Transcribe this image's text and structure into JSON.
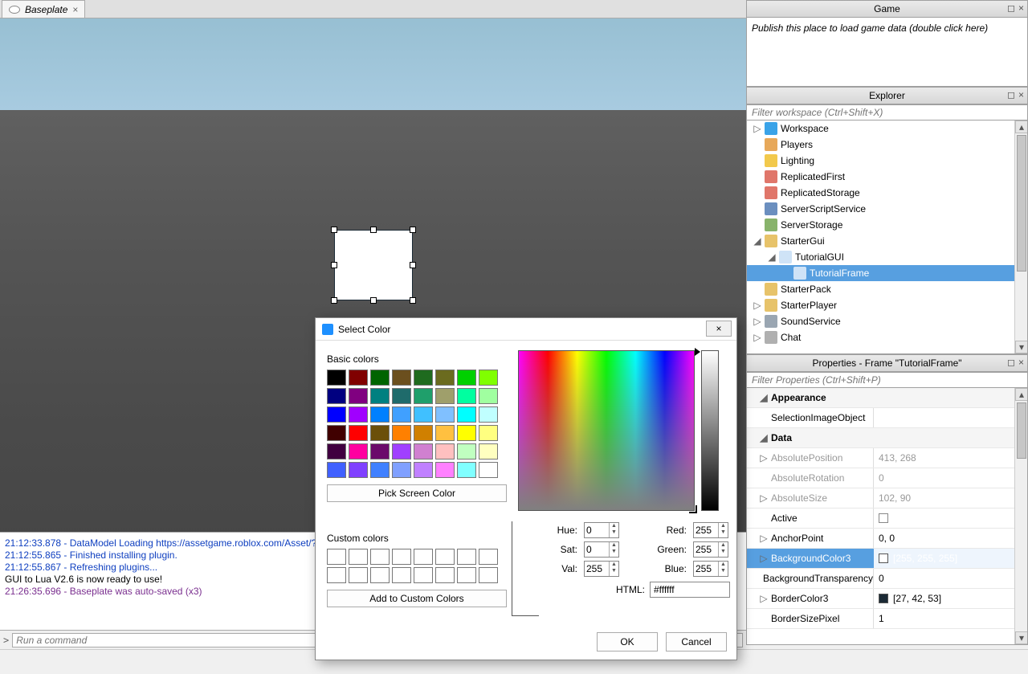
{
  "tab": {
    "title": "Baseplate"
  },
  "panels": {
    "game": {
      "title": "Game",
      "hint": "Publish this place to load game data (double click here)"
    },
    "explorer": {
      "title": "Explorer",
      "filter_placeholder": "Filter workspace (Ctrl+Shift+X)"
    },
    "properties": {
      "title": "Properties - Frame \"TutorialFrame\"",
      "filter_placeholder": "Filter Properties (Ctrl+Shift+P)"
    }
  },
  "explorer_tree": [
    {
      "label": "Workspace",
      "indent": 1,
      "expander": "▷",
      "icon": "#3aa3e8"
    },
    {
      "label": "Players",
      "indent": 1,
      "expander": "",
      "icon": "#e7a85a"
    },
    {
      "label": "Lighting",
      "indent": 1,
      "expander": "",
      "icon": "#f2c94c"
    },
    {
      "label": "ReplicatedFirst",
      "indent": 1,
      "expander": "",
      "icon": "#e0766a"
    },
    {
      "label": "ReplicatedStorage",
      "indent": 1,
      "expander": "",
      "icon": "#e0766a"
    },
    {
      "label": "ServerScriptService",
      "indent": 1,
      "expander": "",
      "icon": "#6b8fbf"
    },
    {
      "label": "ServerStorage",
      "indent": 1,
      "expander": "",
      "icon": "#88b36b"
    },
    {
      "label": "StarterGui",
      "indent": 1,
      "expander": "◢",
      "icon": "#e7c36a"
    },
    {
      "label": "TutorialGUI",
      "indent": 2,
      "expander": "◢",
      "icon": "#cfe3f7"
    },
    {
      "label": "TutorialFrame",
      "indent": 3,
      "expander": "",
      "icon": "#cfe3f7",
      "selected": true
    },
    {
      "label": "StarterPack",
      "indent": 1,
      "expander": "",
      "icon": "#e7c36a"
    },
    {
      "label": "StarterPlayer",
      "indent": 1,
      "expander": "▷",
      "icon": "#e7c36a"
    },
    {
      "label": "SoundService",
      "indent": 1,
      "expander": "▷",
      "icon": "#9aa6b2"
    },
    {
      "label": "Chat",
      "indent": 1,
      "expander": "▷",
      "icon": "#b0b0b0"
    }
  ],
  "props": {
    "sections": [
      "Appearance",
      "Data"
    ],
    "rows": [
      {
        "section": "Appearance"
      },
      {
        "name": "SelectionImageObject",
        "value": ""
      },
      {
        "section": "Data"
      },
      {
        "name": "AbsolutePosition",
        "value": "413, 268",
        "readonly": true,
        "exp": "▷"
      },
      {
        "name": "AbsoluteRotation",
        "value": "0",
        "readonly": true
      },
      {
        "name": "AbsoluteSize",
        "value": "102, 90",
        "readonly": true,
        "exp": "▷"
      },
      {
        "name": "Active",
        "value": "checkbox"
      },
      {
        "name": "AnchorPoint",
        "value": "0, 0",
        "exp": "▷"
      },
      {
        "name": "BackgroundColor3",
        "value": "[255, 255, 255]",
        "swatch": "#ffffff",
        "selected": true,
        "exp": "▷"
      },
      {
        "name": "BackgroundTransparency",
        "value": "0"
      },
      {
        "name": "BorderColor3",
        "value": "[27, 42, 53]",
        "swatch": "#1b2a35",
        "exp": "▷"
      },
      {
        "name": "BorderSizePixel",
        "value": "1"
      }
    ]
  },
  "output": [
    {
      "text": "21:12:33.878 - DataModel Loading https://assetgame.roblox.com/Asset/?id=",
      "color": "#1040c0"
    },
    {
      "text": "21:12:55.865 - Finished installing plugin.",
      "color": "#1040c0"
    },
    {
      "text": "21:12:55.867 - Refreshing plugins...",
      "color": "#1040c0"
    },
    {
      "text": "GUI to Lua V2.6 is now ready to use!",
      "color": "#000"
    },
    {
      "text": "21:26:35.696 - Baseplate was auto-saved (x3)",
      "color": "#7a2f8f"
    }
  ],
  "command": {
    "placeholder": "Run a command"
  },
  "dialog": {
    "title": "Select Color",
    "basic_label": "Basic colors",
    "custom_label": "Custom colors",
    "pick_btn": "Pick Screen Color",
    "add_btn": "Add to Custom Colors",
    "ok": "OK",
    "cancel": "Cancel",
    "fields": {
      "hue": {
        "label": "Hue:",
        "value": "0"
      },
      "sat": {
        "label": "Sat:",
        "value": "0"
      },
      "val": {
        "label": "Val:",
        "value": "255"
      },
      "red": {
        "label": "Red:",
        "value": "255"
      },
      "green": {
        "label": "Green:",
        "value": "255"
      },
      "blue": {
        "label": "Blue:",
        "value": "255"
      },
      "html": {
        "label": "HTML:",
        "value": "#ffffff"
      }
    },
    "basic_colors": [
      "#000000",
      "#800000",
      "#006400",
      "#6b4f1e",
      "#1f6b1f",
      "#6b6b1f",
      "#00d000",
      "#80ff00",
      "#000080",
      "#800080",
      "#008080",
      "#1f6b6b",
      "#1f9f6b",
      "#9f9f6b",
      "#00ffa0",
      "#a0ffa0",
      "#0000ff",
      "#a000ff",
      "#0080ff",
      "#40a0ff",
      "#40c0ff",
      "#80c0ff",
      "#00ffff",
      "#c0ffff",
      "#400000",
      "#ff0000",
      "#6b4f0a",
      "#ff8000",
      "#d08000",
      "#ffc040",
      "#ffff00",
      "#ffff80",
      "#400040",
      "#ff00a0",
      "#6b0a6b",
      "#a040ff",
      "#d080d0",
      "#ffc0c0",
      "#c0ffc0",
      "#ffffc0",
      "#4060ff",
      "#8040ff",
      "#4080ff",
      "#80a0ff",
      "#c080ff",
      "#ff80ff",
      "#80ffff",
      "#ffffff"
    ]
  }
}
